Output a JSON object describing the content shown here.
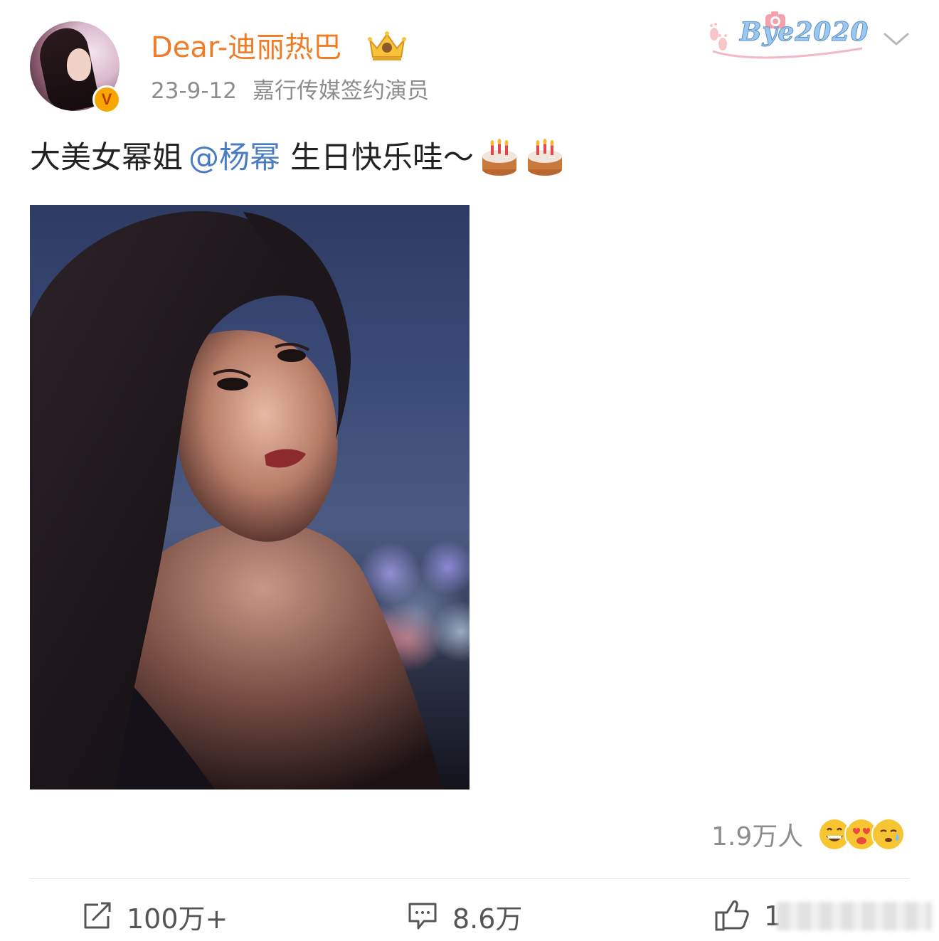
{
  "post": {
    "author": {
      "name": "Dear-迪丽热巴",
      "verified_badge": "V",
      "date": "23-9-12",
      "description": "嘉行传媒签约演员",
      "avatar_icon": "avatar-photo",
      "member_icon": "crown-icon"
    },
    "decoration": {
      "badge_text": "Bye2020"
    },
    "text": {
      "before_mention": "大美女幂姐",
      "mention": "@杨幂",
      "after_mention": "生日快乐哇～"
    },
    "emojis": [
      "birthday-cake-icon",
      "birthday-cake-icon"
    ],
    "image": {
      "alt_icon": "portrait-photo"
    },
    "reactions": {
      "count": "1.9万人",
      "icons": [
        "grin-emoji",
        "love-emoji",
        "sweat-emoji"
      ]
    },
    "actions": {
      "repost": "100万+",
      "comment": "8.6万",
      "like": "1"
    }
  },
  "colors": {
    "username": "#f07c28",
    "mention": "#4a7cc4",
    "meta": "#8d8d8d",
    "verified": "#f7a800"
  }
}
